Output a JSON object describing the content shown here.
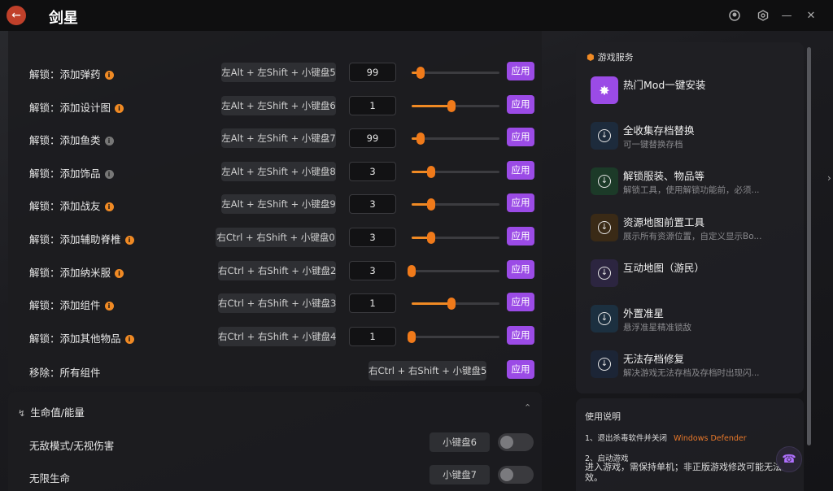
{
  "app": {
    "title": "剑星"
  },
  "titlebar": {
    "back_icon": "arrow-left-icon",
    "icons": [
      "user-icon",
      "settings-icon",
      "minimize-icon",
      "close-icon"
    ]
  },
  "colors": {
    "accent": "#9b4be6",
    "slider": "#f08a24",
    "back": "#c0402a"
  },
  "cheats": [
    {
      "label": "解锁：添加弹药",
      "info": "orange",
      "hotkey": "左Alt + 左Shift + 小键盘5",
      "value": "99",
      "slider": 0.1,
      "apply": "应用"
    },
    {
      "label": "解锁：添加设计图",
      "info": "orange",
      "hotkey": "左Alt + 左Shift + 小键盘6",
      "value": "1",
      "slider": 0.45,
      "apply": "应用"
    },
    {
      "label": "解锁：添加鱼类",
      "info": "gray",
      "hotkey": "左Alt + 左Shift + 小键盘7",
      "value": "99",
      "slider": 0.1,
      "apply": "应用"
    },
    {
      "label": "解锁：添加饰品",
      "info": "gray",
      "hotkey": "左Alt + 左Shift + 小键盘8",
      "value": "3",
      "slider": 0.22,
      "apply": "应用"
    },
    {
      "label": "解锁：添加战友",
      "info": "orange",
      "hotkey": "左Alt + 左Shift + 小键盘9",
      "value": "3",
      "slider": 0.22,
      "apply": "应用"
    },
    {
      "label": "解锁：添加辅助脊椎",
      "info": "orange",
      "hotkey": "右Ctrl + 右Shift + 小键盘0",
      "value": "3",
      "slider": 0.22,
      "apply": "应用"
    },
    {
      "label": "解锁：添加纳米服",
      "info": "orange",
      "hotkey": "右Ctrl + 右Shift + 小键盘2",
      "value": "3",
      "slider": 0.0,
      "apply": "应用"
    },
    {
      "label": "解锁：添加组件",
      "info": "orange",
      "hotkey": "右Ctrl + 右Shift + 小键盘3",
      "value": "1",
      "slider": 0.45,
      "apply": "应用"
    },
    {
      "label": "解锁：添加其他物品",
      "info": "orange",
      "hotkey": "右Ctrl + 右Shift + 小键盘4",
      "value": "1",
      "slider": 0.0,
      "apply": "应用"
    }
  ],
  "remove_row": {
    "label": "移除：所有组件",
    "hotkey": "右Ctrl + 右Shift + 小键盘5",
    "apply": "应用"
  },
  "health_section": {
    "title": "生命值/能量",
    "rows": [
      {
        "label": "无敌模式/无视伤害",
        "key": "小键盘6",
        "on": false
      },
      {
        "label": "无限生命",
        "key": "小键盘7",
        "on": false
      }
    ]
  },
  "services": {
    "title": "游戏服务",
    "items": [
      {
        "title": "热门Mod一键安装",
        "sub": "",
        "icon": "mod-icon"
      },
      {
        "title": "全收集存档替换",
        "sub": "可一键替换存档",
        "icon": "download-icon"
      },
      {
        "title": "解锁服装、物品等",
        "sub": "解锁工具，使用解锁功能前，必须...",
        "icon": "download-icon"
      },
      {
        "title": "资源地图前置工具",
        "sub": "展示所有资源位置，自定义显示Bo...",
        "icon": "download-icon"
      },
      {
        "title": "互动地图（游民）",
        "sub": "",
        "icon": "download-icon"
      },
      {
        "title": "外置准星",
        "sub": "悬浮准星精准锁敌",
        "icon": "download-icon"
      },
      {
        "title": "无法存档修复",
        "sub": "解决游戏无法存档及存档时出现闪...",
        "icon": "download-icon"
      }
    ]
  },
  "usage": {
    "title": "使用说明",
    "step1": "1、退出杀毒软件并关闭",
    "step1_link": "Windows Defender",
    "step2": "2、启动游戏",
    "step2_body": "进入游戏，需保持单机；非正版游戏修改可能无法生效。"
  }
}
